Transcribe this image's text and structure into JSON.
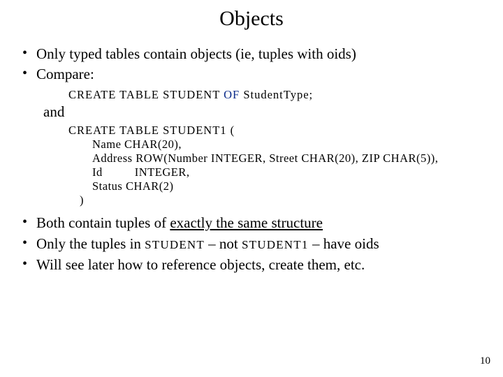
{
  "title": "Objects",
  "bullets_top": [
    "Only typed tables contain objects (ie, tuples with oids)",
    "Compare:"
  ],
  "code1": {
    "pre": "CREATE  TABLE  STUDENT  ",
    "of": "OF",
    "post": "  StudentType;"
  },
  "and": "and",
  "code2": {
    "head": "CREATE  TABLE  STUDENT1  (",
    "f1": "Name   CHAR(20),",
    "f2": "Address  ROW(Number INTEGER, Street CHAR(20), ZIP  CHAR(5)),",
    "f3_a": "Id",
    "f3_b": "INTEGER,",
    "f4": "Status   CHAR(2)",
    "close": ")"
  },
  "bottom": {
    "b1_a": "Both contain tuples of ",
    "b1_u": "exactly the same structure",
    "b2_a": "Only the tuples in ",
    "b2_s1": " STUDENT ",
    "b2_b": "  –  not ",
    "b2_s2": " STUDENT1 ",
    "b2_c": "  –  have oids",
    "b3": "Will see later how to reference objects, create them, etc."
  },
  "pagenum": "10"
}
